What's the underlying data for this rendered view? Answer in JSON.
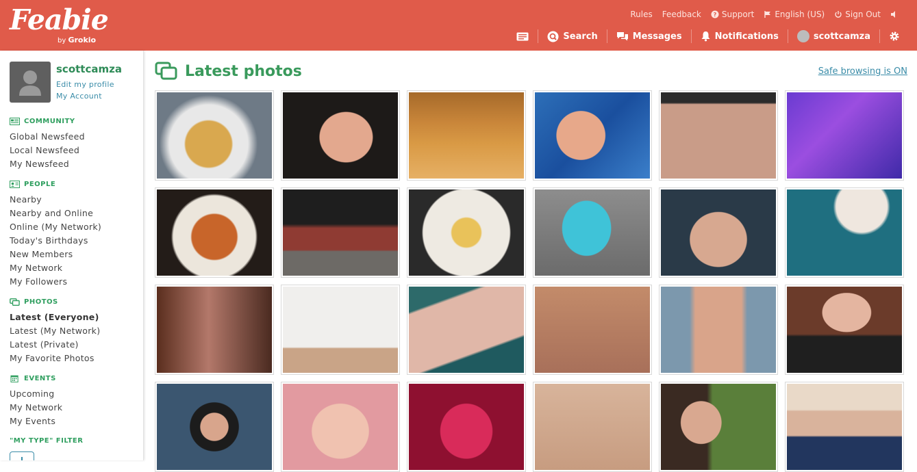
{
  "header": {
    "logo": "Feabie",
    "logo_by": "by",
    "logo_brand": "Grokio",
    "top_links": [
      "Rules",
      "Feedback",
      "Support",
      "English (US)",
      "Sign Out"
    ],
    "nav": {
      "search": "Search",
      "messages": "Messages",
      "notifications": "Notifications",
      "user": "scottcamza"
    }
  },
  "sidebar": {
    "username": "scottcamza",
    "edit_profile": "Edit my profile",
    "my_account": "My Account",
    "community": {
      "title": "COMMUNITY",
      "items": [
        "Global Newsfeed",
        "Local Newsfeed",
        "My Newsfeed"
      ]
    },
    "people": {
      "title": "PEOPLE",
      "items": [
        "Nearby",
        "Nearby and Online",
        "Online (My Network)",
        "Today's Birthdays",
        "New Members",
        "My Network",
        "My Followers"
      ]
    },
    "photos": {
      "title": "PHOTOS",
      "items": [
        "Latest (Everyone)",
        "Latest (My Network)",
        "Latest (Private)",
        "My Favorite Photos"
      ],
      "active": "Latest (Everyone)"
    },
    "events": {
      "title": "EVENTS",
      "items": [
        "Upcoming",
        "My Network",
        "My Events"
      ]
    },
    "filter": {
      "title": "\"MY TYPE\" FILTER"
    }
  },
  "main": {
    "title": "Latest photos",
    "safe_browsing": "Safe browsing is ON"
  },
  "colors": {
    "header_bg": "#e05b4a",
    "accent_green": "#3a9a5c",
    "link_blue": "#3a8ca8"
  }
}
